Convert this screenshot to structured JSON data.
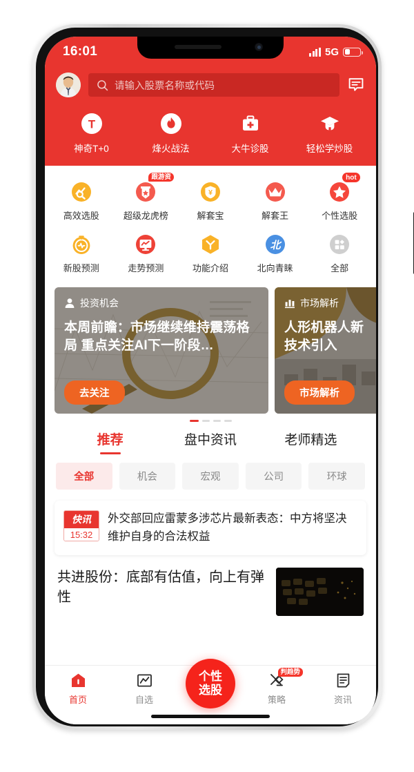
{
  "status_bar": {
    "time": "16:01",
    "network": "5G",
    "signal_icon": "signal-bars-icon",
    "battery_icon": "battery-icon"
  },
  "header": {
    "avatar_icon": "user-avatar",
    "search": {
      "placeholder": "请输入股票名称或代码",
      "icon": "search-icon"
    },
    "message_icon": "message-icon"
  },
  "quick_actions": [
    {
      "label": "神奇T+0",
      "icon": "t-plus-zero-icon"
    },
    {
      "label": "烽火战法",
      "icon": "flame-icon"
    },
    {
      "label": "大牛诊股",
      "icon": "medical-kit-icon"
    },
    {
      "label": "轻松学炒股",
      "icon": "graduation-cap-icon"
    }
  ],
  "grid": {
    "row1": [
      {
        "label": "高效选股",
        "icon": "chart-search-icon",
        "color": "#F9B228",
        "badge": ""
      },
      {
        "label": "超级龙虎榜",
        "icon": "banner-star-icon",
        "color": "#F45A4E",
        "badge": "跟游资"
      },
      {
        "label": "解套宝",
        "icon": "shield-yuan-icon",
        "color": "#F9B228",
        "badge": ""
      },
      {
        "label": "解套王",
        "icon": "crown-icon",
        "color": "#F45A4E",
        "badge": ""
      },
      {
        "label": "个性选股",
        "icon": "star-circle-icon",
        "color": "#F5463B",
        "badge": "hot"
      }
    ],
    "row2": [
      {
        "label": "新股预测",
        "icon": "stopwatch-pulse-icon",
        "color": "#F9B228",
        "badge": ""
      },
      {
        "label": "走势预测",
        "icon": "monitor-chart-icon",
        "color": "#EE4237",
        "badge": ""
      },
      {
        "label": "功能介绍",
        "icon": "hexagon-y-icon",
        "color": "#F9B228",
        "badge": ""
      },
      {
        "label": "北向青睐",
        "icon": "bei-circle-icon",
        "color": "#4A90E2",
        "badge": ""
      },
      {
        "label": "全部",
        "icon": "grid-all-icon",
        "color": "#CFCFCF",
        "badge": ""
      }
    ]
  },
  "banners": {
    "cards": [
      {
        "tag": "投资机会",
        "tag_icon": "person-icon",
        "title": "本周前瞻：市场继续维持震荡格局  重点关注AI下一阶段…",
        "button": "去关注"
      },
      {
        "tag": "市场解析",
        "tag_icon": "bar-chart-icon",
        "title": "人形机器人新技术引入",
        "button": "市场解析"
      }
    ],
    "dots_total": 4,
    "dots_active": 0
  },
  "content_tabs": [
    {
      "label": "推荐",
      "active": true
    },
    {
      "label": "盘中资讯",
      "active": false
    },
    {
      "label": "老师精选",
      "active": false
    }
  ],
  "filter_chips": [
    {
      "label": "全部",
      "active": true
    },
    {
      "label": "机会",
      "active": false
    },
    {
      "label": "宏观",
      "active": false
    },
    {
      "label": "公司",
      "active": false
    },
    {
      "label": "环球",
      "active": false
    }
  ],
  "news": {
    "flash": {
      "badge_label": "快讯",
      "time": "15:32",
      "text": "外交部回应雷蒙多涉芯片最新表态：中方将坚决维护自身的合法权益"
    },
    "article": {
      "title": "共进股份：底部有估值，向上有弹性",
      "thumb_icon": "news-thumbnail"
    }
  },
  "tab_bar": [
    {
      "label": "首页",
      "icon": "home-icon",
      "active": true,
      "badge": ""
    },
    {
      "label": "自选",
      "icon": "watchlist-chart-icon",
      "active": false,
      "badge": ""
    },
    {
      "label": "策略",
      "icon": "strategy-compass-icon",
      "active": false,
      "badge": "判趋势"
    },
    {
      "label": "资讯",
      "icon": "news-document-icon",
      "active": false,
      "badge": ""
    }
  ],
  "center_fab": {
    "line1": "个性",
    "line2": "选股",
    "icon": "personal-stock-pick-button"
  },
  "colors": {
    "brand_red": "#E8352F",
    "fab_red": "#F5231B",
    "orange_btn": "#EE6422",
    "gold": "#F9B228",
    "blue": "#4A90E2"
  }
}
